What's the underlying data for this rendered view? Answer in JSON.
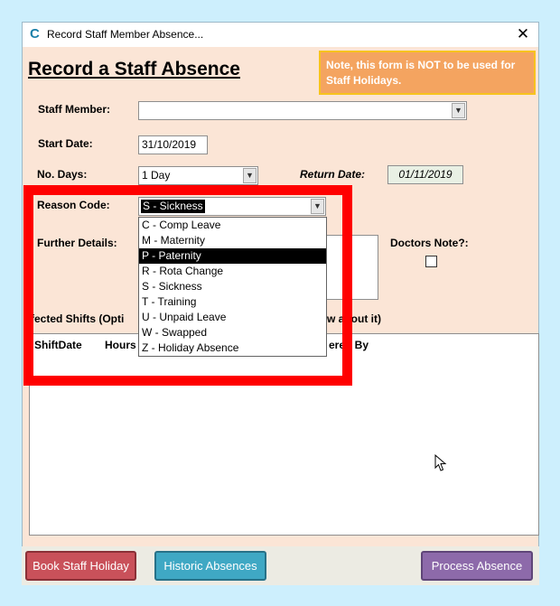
{
  "window": {
    "title": "Record Staff Member Absence...",
    "close_symbol": "✕"
  },
  "form": {
    "title": "Record a Staff Absence",
    "note": "Note, this form is NOT to be used for Staff Holidays."
  },
  "fields": {
    "staff_member_label": "Staff Member:",
    "staff_member_value": "",
    "start_date_label": "Start Date:",
    "start_date_value": "31/10/2019",
    "no_days_label": "No. Days:",
    "no_days_value": "1 Day",
    "return_date_label": "Return Date:",
    "return_date_value": "01/11/2019",
    "reason_code_label": "Reason Code:",
    "reason_code_value": "S - Sickness",
    "further_details_label": "Further Details:",
    "doctors_note_label": "Doctors Note?:"
  },
  "reason_options": [
    {
      "label": "C - Comp Leave",
      "selected": false
    },
    {
      "label": "M - Maternity",
      "selected": false
    },
    {
      "label": "P - Paternity",
      "selected": true
    },
    {
      "label": "R - Rota Change",
      "selected": false
    },
    {
      "label": "S - Sickness",
      "selected": false
    },
    {
      "label": "T - Training",
      "selected": false
    },
    {
      "label": "U - Unpaid Leave",
      "selected": false
    },
    {
      "label": "W - Swapped",
      "selected": false
    },
    {
      "label": "Z - Holiday Absence",
      "selected": false
    }
  ],
  "shifts": {
    "label_left": "ffected Shifts (Opti",
    "label_right": "w about it)",
    "columns": {
      "shift_date": "ShiftDate",
      "hours": "Hours",
      "covered_by": "ered By"
    }
  },
  "buttons": {
    "book_holiday": "Book Staff Holiday",
    "historic": "Historic Absences",
    "process": "Process Absence"
  },
  "colors": {
    "form_bg": "#fbe5d6",
    "note_bg": "#f4a460",
    "highlight": "#ff0000",
    "btn_red": "#c9515a",
    "btn_teal": "#3fa8c4",
    "btn_purple": "#8d6aaa"
  }
}
